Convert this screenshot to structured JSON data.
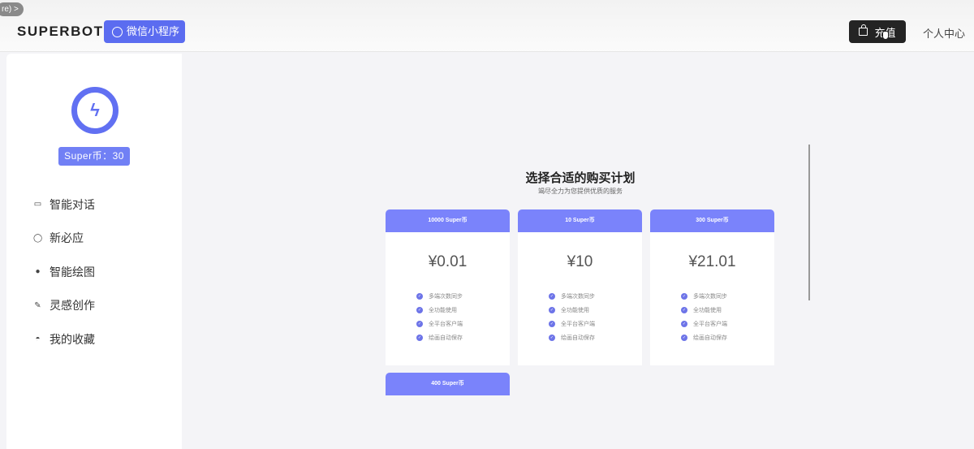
{
  "overlay_pill": "re) >",
  "header": {
    "logo": "SUPERBOT",
    "mini_program": "微信小程序",
    "recharge": "充值",
    "user_center": "个人中心"
  },
  "sidebar": {
    "coins": "Super币：30",
    "items": [
      {
        "label": "智能对话",
        "icon": "chat-square-icon"
      },
      {
        "label": "新必应",
        "icon": "chat-bubble-icon"
      },
      {
        "label": "智能绘图",
        "icon": "paint-icon"
      },
      {
        "label": "灵感创作",
        "icon": "pen-icon"
      },
      {
        "label": "我的收藏",
        "icon": "collection-icon"
      }
    ]
  },
  "main": {
    "title": "选择合适的购买计划",
    "subtitle": "竭尽全力为您提供优质的服务",
    "plans": [
      {
        "name": "10000 Super币",
        "price": "¥0.01",
        "features": [
          "多端次数同步",
          "全功能使用",
          "全平台客户端",
          "绘画自动保存"
        ]
      },
      {
        "name": "10 Super币",
        "price": "¥10",
        "features": [
          "多端次数同步",
          "全功能使用",
          "全平台客户端",
          "绘画自动保存"
        ]
      },
      {
        "name": "300 Super币",
        "price": "¥21.01",
        "features": [
          "多端次数同步",
          "全功能使用",
          "全平台客户端",
          "绘画自动保存"
        ]
      },
      {
        "name": "400 Super币",
        "price": "",
        "features": []
      }
    ]
  },
  "colors": {
    "accent": "#5b6cf0",
    "card_header": "#7a83fb",
    "dark_button": "#242424"
  }
}
